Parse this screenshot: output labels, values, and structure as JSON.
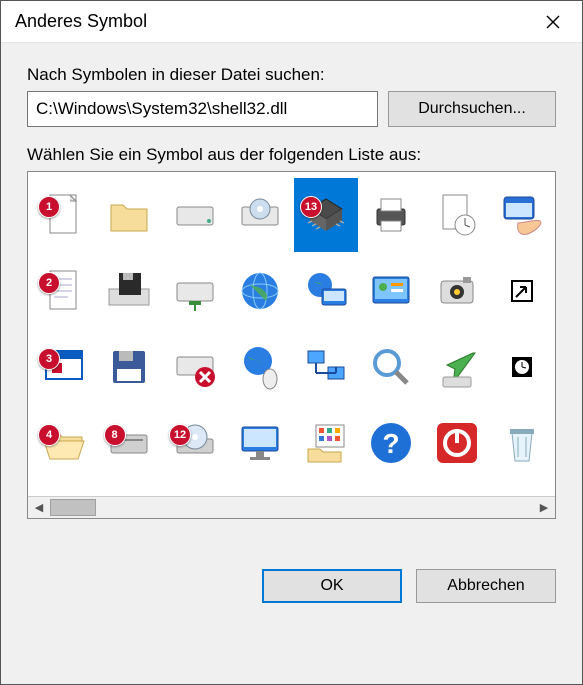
{
  "dialog": {
    "title": "Anderes Symbol",
    "search_label": "Nach Symbolen in dieser Datei suchen:",
    "path_value": "C:\\Windows\\System32\\shell32.dll",
    "browse_label": "Durchsuchen...",
    "select_label": "Wählen Sie ein Symbol aus der folgenden Liste aus:",
    "ok_label": "OK",
    "cancel_label": "Abbrechen"
  },
  "icons": {
    "selected_index": 4,
    "grid": [
      {
        "name": "blank-document-icon",
        "badge": "1"
      },
      {
        "name": "folder-icon"
      },
      {
        "name": "hard-drive-icon"
      },
      {
        "name": "cd-drive-icon"
      },
      {
        "name": "chip-icon",
        "badge": "13",
        "selected": true
      },
      {
        "name": "printer-icon"
      },
      {
        "name": "document-clock-icon"
      },
      {
        "name": "window-hand-icon"
      },
      {
        "name": "text-document-icon",
        "badge": "2"
      },
      {
        "name": "floppy-drive-icon"
      },
      {
        "name": "network-drive-icon"
      },
      {
        "name": "globe-internet-icon"
      },
      {
        "name": "globe-monitor-icon"
      },
      {
        "name": "control-panel-icon"
      },
      {
        "name": "camera-icon"
      },
      {
        "name": "shortcut-arrow-icon"
      },
      {
        "name": "program-window-icon",
        "badge": "3"
      },
      {
        "name": "floppy-disk-icon"
      },
      {
        "name": "drive-disconnected-icon"
      },
      {
        "name": "globe-mouse-icon"
      },
      {
        "name": "network-computers-icon"
      },
      {
        "name": "magnifier-icon"
      },
      {
        "name": "green-arrow-icon"
      },
      {
        "name": "clock-small-icon"
      },
      {
        "name": "folder-open-icon",
        "badge": "4"
      },
      {
        "name": "drive-alt-icon",
        "badge": "8"
      },
      {
        "name": "cd-drive-alt-icon",
        "badge": "12"
      },
      {
        "name": "monitor-icon"
      },
      {
        "name": "program-grid-folder-icon"
      },
      {
        "name": "help-icon"
      },
      {
        "name": "shutdown-icon"
      },
      {
        "name": "recycle-bin-icon"
      }
    ]
  }
}
